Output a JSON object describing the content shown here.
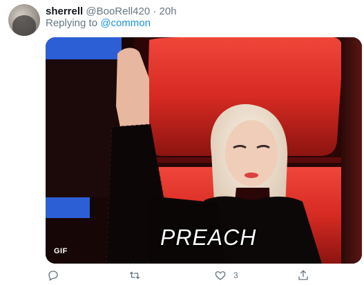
{
  "tweet": {
    "display_name": "sherrell",
    "handle": "@BooRell420",
    "separator": "·",
    "time": "20h",
    "replying_prefix": "Replying to",
    "replying_mention": "@common"
  },
  "media": {
    "badge": "GIF",
    "caption": "PREACH"
  },
  "actions": {
    "reply_icon": "reply-icon",
    "retweet_icon": "retweet-icon",
    "like_icon": "heart-icon",
    "like_count": "3",
    "share_icon": "share-icon"
  },
  "colors": {
    "text_secondary": "#657786",
    "link": "#1b95e0",
    "name": "#14171a"
  }
}
